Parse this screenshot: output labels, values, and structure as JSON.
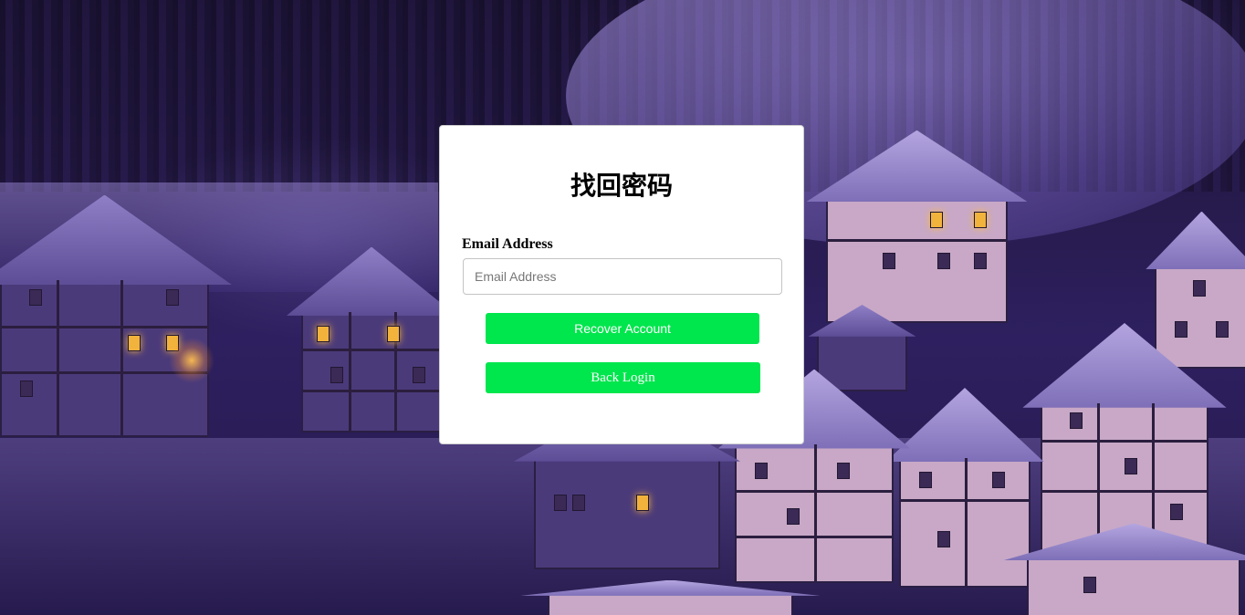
{
  "page": {
    "title": "找回密码"
  },
  "form": {
    "email_label": "Email Address",
    "email_placeholder": "Email Address",
    "email_value": ""
  },
  "buttons": {
    "recover_label": "Recover Account",
    "back_label": "Back Login"
  },
  "colors": {
    "button_accent": "#00e64d",
    "card_background": "#ffffff",
    "background_tone": "#2a1c55"
  }
}
